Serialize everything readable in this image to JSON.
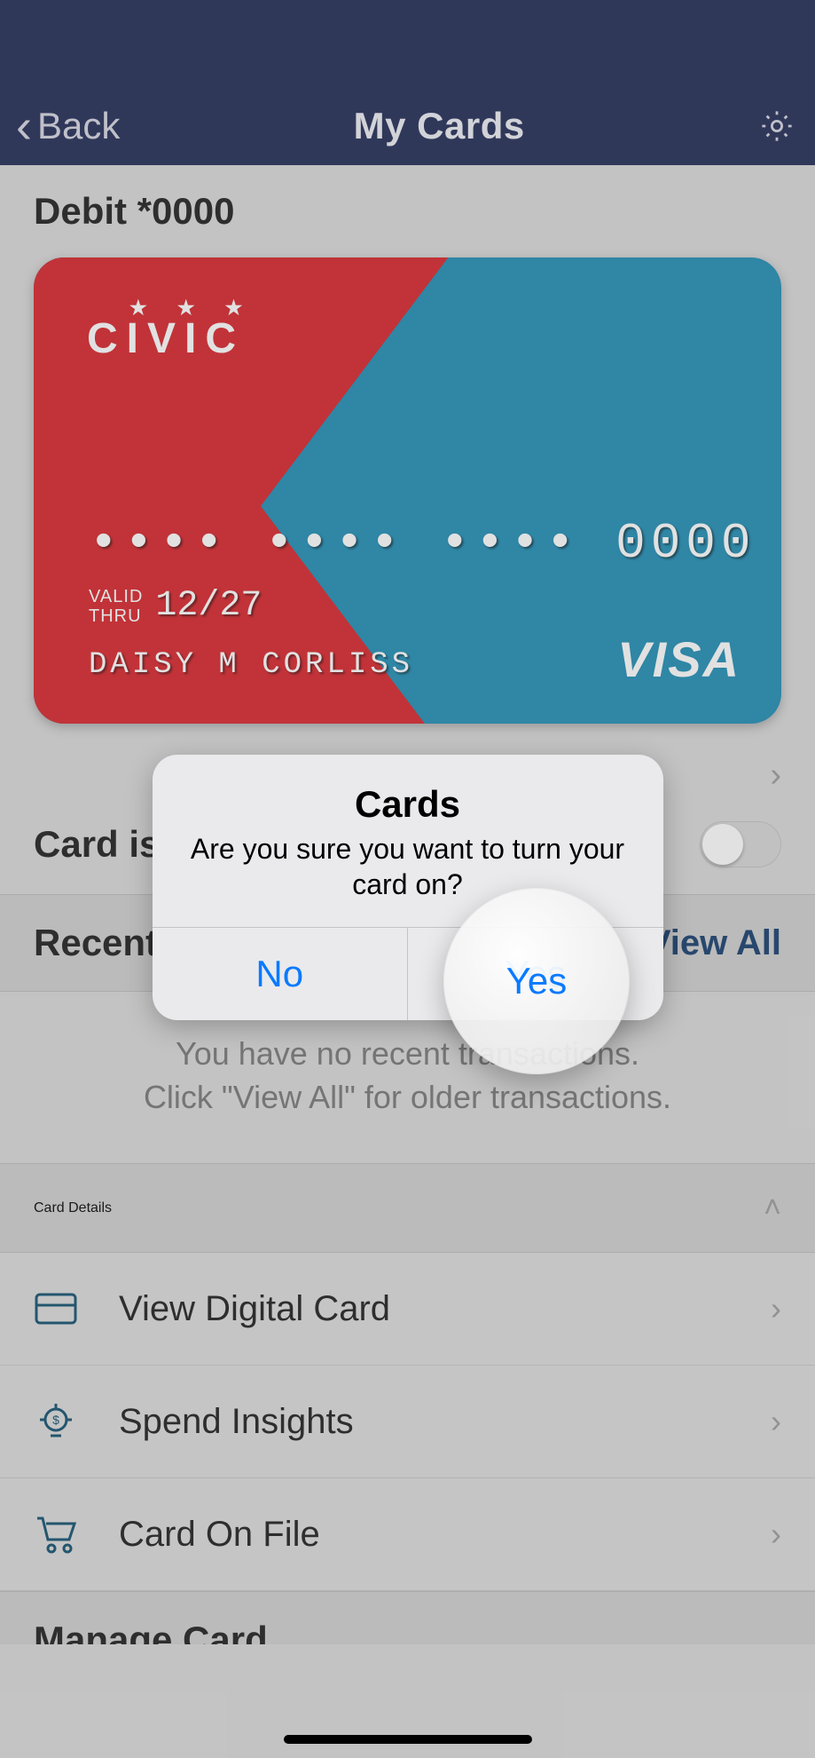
{
  "nav": {
    "back": "Back",
    "title": "My Cards"
  },
  "card": {
    "label": "Debit *0000",
    "brand": "CIVIC",
    "number_masked": "•••• •••• •••• 0000",
    "valid_label": "VALID\nTHRU",
    "valid_thru": "12/27",
    "holder": "DAISY M CORLISS",
    "network": "VISA"
  },
  "toggle": {
    "label": "Card is On",
    "state": false
  },
  "recent": {
    "header": "Recent Transactions",
    "view_all": "View All",
    "empty_line1": "You have no recent transactions.",
    "empty_line2": "Click \"View All\" for older transactions."
  },
  "details": {
    "header": "Card Details",
    "items": [
      {
        "icon": "card-icon",
        "label": "View Digital Card"
      },
      {
        "icon": "bulb-icon",
        "label": "Spend Insights"
      },
      {
        "icon": "cart-icon",
        "label": "Card On File"
      }
    ]
  },
  "manage": {
    "header": "Manage Card"
  },
  "alert": {
    "title": "Cards",
    "message": "Are you sure you want to turn your card on?",
    "no": "No",
    "yes": "Yes"
  },
  "colors": {
    "nav_bg": "#1d2753",
    "card_red": "#d62027",
    "card_blue": "#1b8bb3",
    "link_blue": "#0a7aff",
    "brand_blue": "#123a6b",
    "icon_teal": "#0e4d6c"
  }
}
